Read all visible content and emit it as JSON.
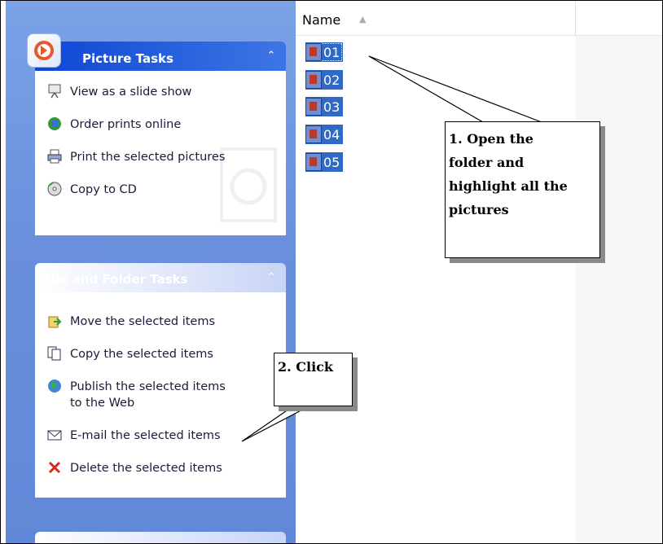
{
  "task_pane": {
    "picture_tasks": {
      "title": "Picture Tasks",
      "items": [
        {
          "label": "View as a slide show",
          "icon": "slideshow-icon"
        },
        {
          "label": "Order prints online",
          "icon": "order-prints-icon"
        },
        {
          "label": "Print the selected pictures",
          "icon": "printer-icon"
        },
        {
          "label": "Copy to CD",
          "icon": "cd-icon"
        }
      ]
    },
    "file_folder_tasks": {
      "title": "File and Folder Tasks",
      "items": [
        {
          "label": "Move the selected items",
          "icon": "move-icon"
        },
        {
          "label": "Copy the selected items",
          "icon": "copy-icon"
        },
        {
          "label": "Publish the selected items",
          "label2": "to the Web",
          "icon": "globe-icon"
        },
        {
          "label": "E-mail the selected items",
          "icon": "email-icon"
        },
        {
          "label": "Delete the selected items",
          "icon": "delete-icon"
        }
      ]
    }
  },
  "list": {
    "column_name": "Name",
    "files": [
      "01",
      "02",
      "03",
      "04",
      "05"
    ]
  },
  "callouts": {
    "step1": [
      "1. Open the",
      "folder and",
      "highlight all the",
      "pictures"
    ],
    "step2": "2. Click"
  },
  "colors": {
    "pane_blue": "#6a8fdc",
    "header_dark": "#0c46d6",
    "selection": "#316ac5"
  }
}
